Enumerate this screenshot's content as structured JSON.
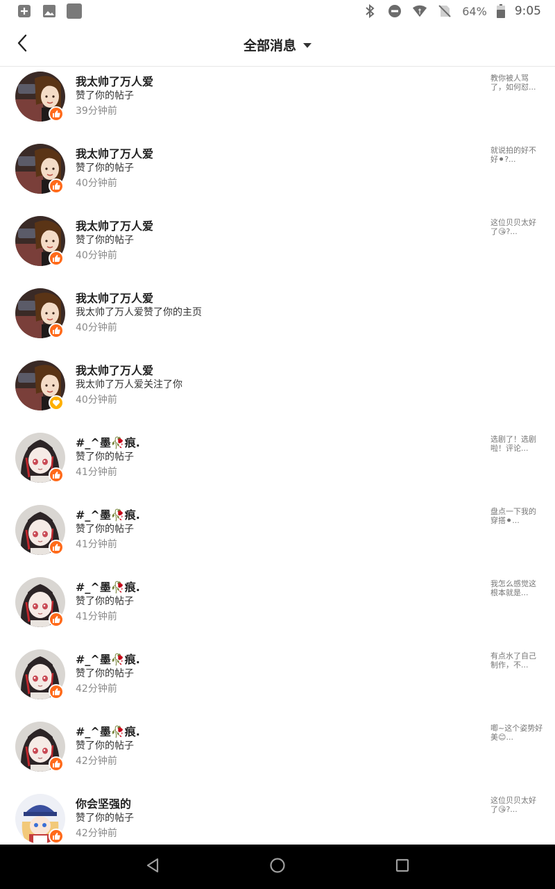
{
  "status_bar": {
    "battery_percent": "64%",
    "time": "9:05",
    "left_icons": [
      "add-box-icon",
      "image-icon",
      "app-square-icon"
    ],
    "right_icons": [
      "bluetooth-icon",
      "do-not-disturb-icon",
      "wifi-icon",
      "no-sim-icon",
      "battery-icon"
    ]
  },
  "header": {
    "title": "全部消息",
    "back_icon": "chevron-left-icon",
    "dropdown_icon": "caret-down-icon"
  },
  "messages": [
    {
      "name": "我太帅了万人爱",
      "action": "赞了你的帖子",
      "time": "39分钟前",
      "preview": "教你被人骂了，如何怼...",
      "badge": "like",
      "avatar": "girl-brown"
    },
    {
      "name": "我太帅了万人爱",
      "action": "赞了你的帖子",
      "time": "40分钟前",
      "preview": "就说拍的好不好⚫?...",
      "badge": "like",
      "avatar": "girl-brown"
    },
    {
      "name": "我太帅了万人爱",
      "action": "赞了你的帖子",
      "time": "40分钟前",
      "preview": "这位贝贝太好了😘?...",
      "badge": "like",
      "avatar": "girl-brown"
    },
    {
      "name": "我太帅了万人爱",
      "action": "我太帅了万人爱赞了你的主页",
      "time": "40分钟前",
      "preview": "",
      "badge": "like",
      "avatar": "girl-brown"
    },
    {
      "name": "我太帅了万人爱",
      "action": "我太帅了万人爱关注了你",
      "time": "40分钟前",
      "preview": "",
      "badge": "follow",
      "avatar": "girl-brown"
    },
    {
      "name": "#_^墨🥀痕.",
      "action": "赞了你的帖子",
      "time": "41分钟前",
      "preview": "选剧了！选剧啦！评论...",
      "badge": "like",
      "avatar": "anime-dark"
    },
    {
      "name": "#_^墨🥀痕.",
      "action": "赞了你的帖子",
      "time": "41分钟前",
      "preview": "盘点一下我的穿搭⚫...",
      "badge": "like",
      "avatar": "anime-dark"
    },
    {
      "name": "#_^墨🥀痕.",
      "action": "赞了你的帖子",
      "time": "41分钟前",
      "preview": "我怎么感觉这根本就是...",
      "badge": "like",
      "avatar": "anime-dark"
    },
    {
      "name": "#_^墨🥀痕.",
      "action": "赞了你的帖子",
      "time": "42分钟前",
      "preview": "有点水了自己制作，不...",
      "badge": "like",
      "avatar": "anime-dark"
    },
    {
      "name": "#_^墨🥀痕.",
      "action": "赞了你的帖子",
      "time": "42分钟前",
      "preview": "唧~这个姿势好美😊...",
      "badge": "like",
      "avatar": "anime-dark"
    },
    {
      "name": "你会坚强的",
      "action": "赞了你的帖子",
      "time": "42分钟前",
      "preview": "这位贝贝太好了😘?...",
      "badge": "like",
      "avatar": "anime-cap"
    }
  ],
  "nav_bar": {
    "buttons": [
      "back-triangle-icon",
      "home-circle-icon",
      "recents-square-icon"
    ]
  },
  "colors": {
    "like_badge": "#ff6a1a",
    "follow_badge": "#ffb000",
    "nav_bar": "#000000"
  }
}
